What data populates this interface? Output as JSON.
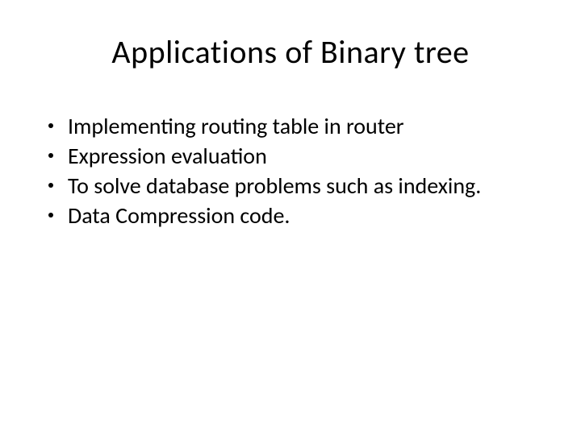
{
  "slide": {
    "title": "Applications of Binary tree",
    "bullets": [
      "Implementing routing table in router",
      "Expression evaluation",
      "To solve database problems such as indexing.",
      "Data Compression code."
    ]
  }
}
